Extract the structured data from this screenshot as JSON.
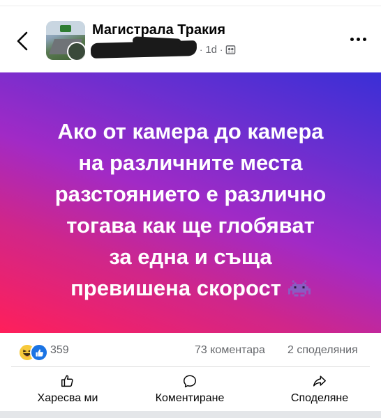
{
  "header": {
    "back_icon": "chevron-left-icon",
    "group_name": "Магистрала Тракия",
    "time_label": "1d",
    "separator": "·",
    "audience_icon": "group-audience-icon",
    "more_icon": "more-horizontal-icon"
  },
  "post": {
    "lines": [
      "Ако от камера до камера",
      "на различните места",
      "разстоянието е различно",
      "тогава как ще глобяват",
      "за една и съща",
      "превишена скорост"
    ],
    "trailing_emoji": "space-invader-emoji",
    "background_colors": [
      "#3a2fd6",
      "#a12ac6",
      "#ff1f5a"
    ]
  },
  "stats": {
    "reactions": [
      "haha",
      "like"
    ],
    "reaction_count": "359",
    "comments": "73 коментара",
    "shares": "2 споделяния"
  },
  "actions": {
    "like": "Харесва ми",
    "comment": "Коментиране",
    "share": "Споделяне"
  },
  "colors": {
    "like_blue": "#1b74e4",
    "secondary_text": "#65676b"
  }
}
